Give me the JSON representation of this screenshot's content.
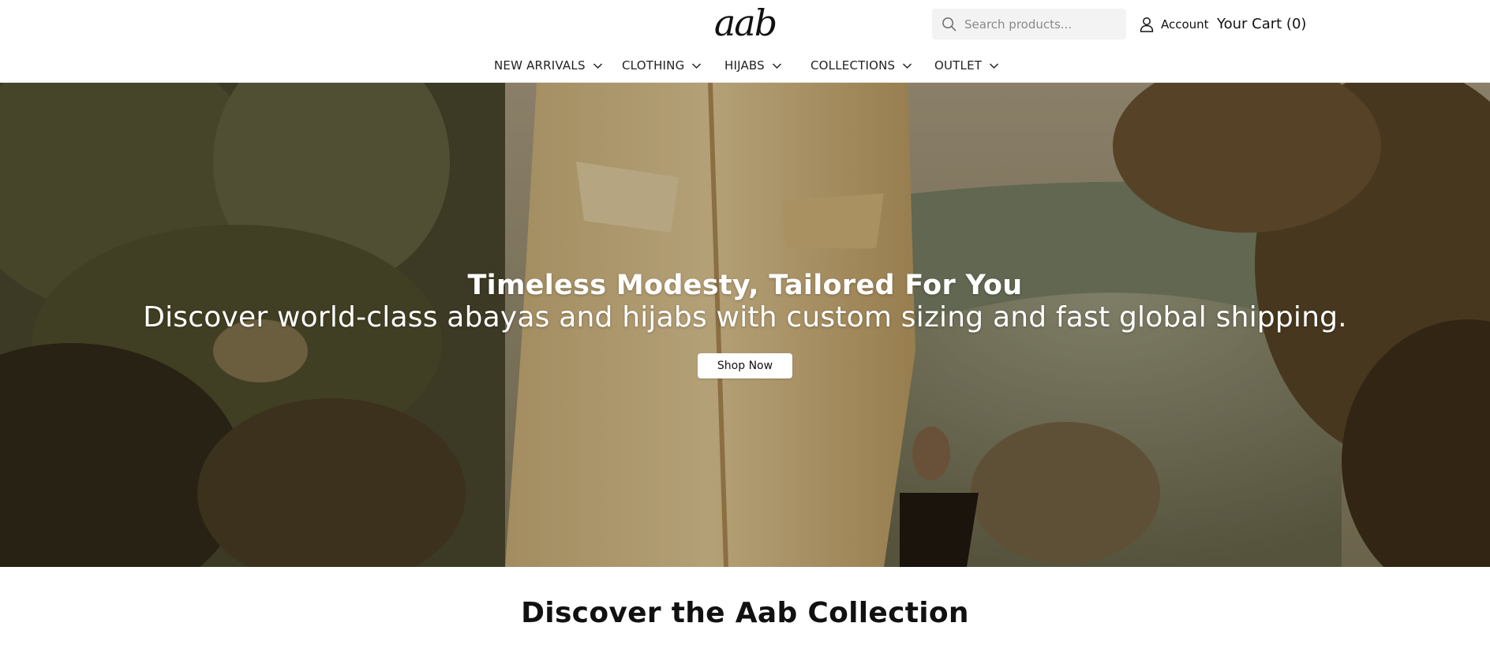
{
  "header": {
    "logo": "aab",
    "search": {
      "placeholder": "Search products...",
      "value": "",
      "icon": "search-icon"
    },
    "account": {
      "label": "Account",
      "icon": "user-icon"
    },
    "cart": {
      "label": "Your Cart (0)"
    }
  },
  "nav": {
    "items": [
      {
        "label": "NEW ARRIVALS",
        "icon": "chevron-down-icon"
      },
      {
        "label": "CLOTHING",
        "icon": "chevron-down-icon"
      },
      {
        "label": "HIJABS",
        "icon": "chevron-down-icon"
      },
      {
        "label": "COLLECTIONS",
        "icon": "chevron-down-icon"
      },
      {
        "label": "OUTLET",
        "icon": "chevron-down-icon"
      }
    ]
  },
  "hero": {
    "title": "Timeless Modesty, Tailored For You",
    "subtitle": "Discover world-class abayas and hijabs with custom sizing and fast global shipping.",
    "cta": "Shop Now"
  },
  "section": {
    "title": "Discover the Aab Collection"
  },
  "colors": {
    "header_bg": "#ffffff",
    "search_bg": "#f3f3f3",
    "text": "#111111",
    "hero_text": "#ffffff",
    "button_bg": "#ffffff"
  }
}
